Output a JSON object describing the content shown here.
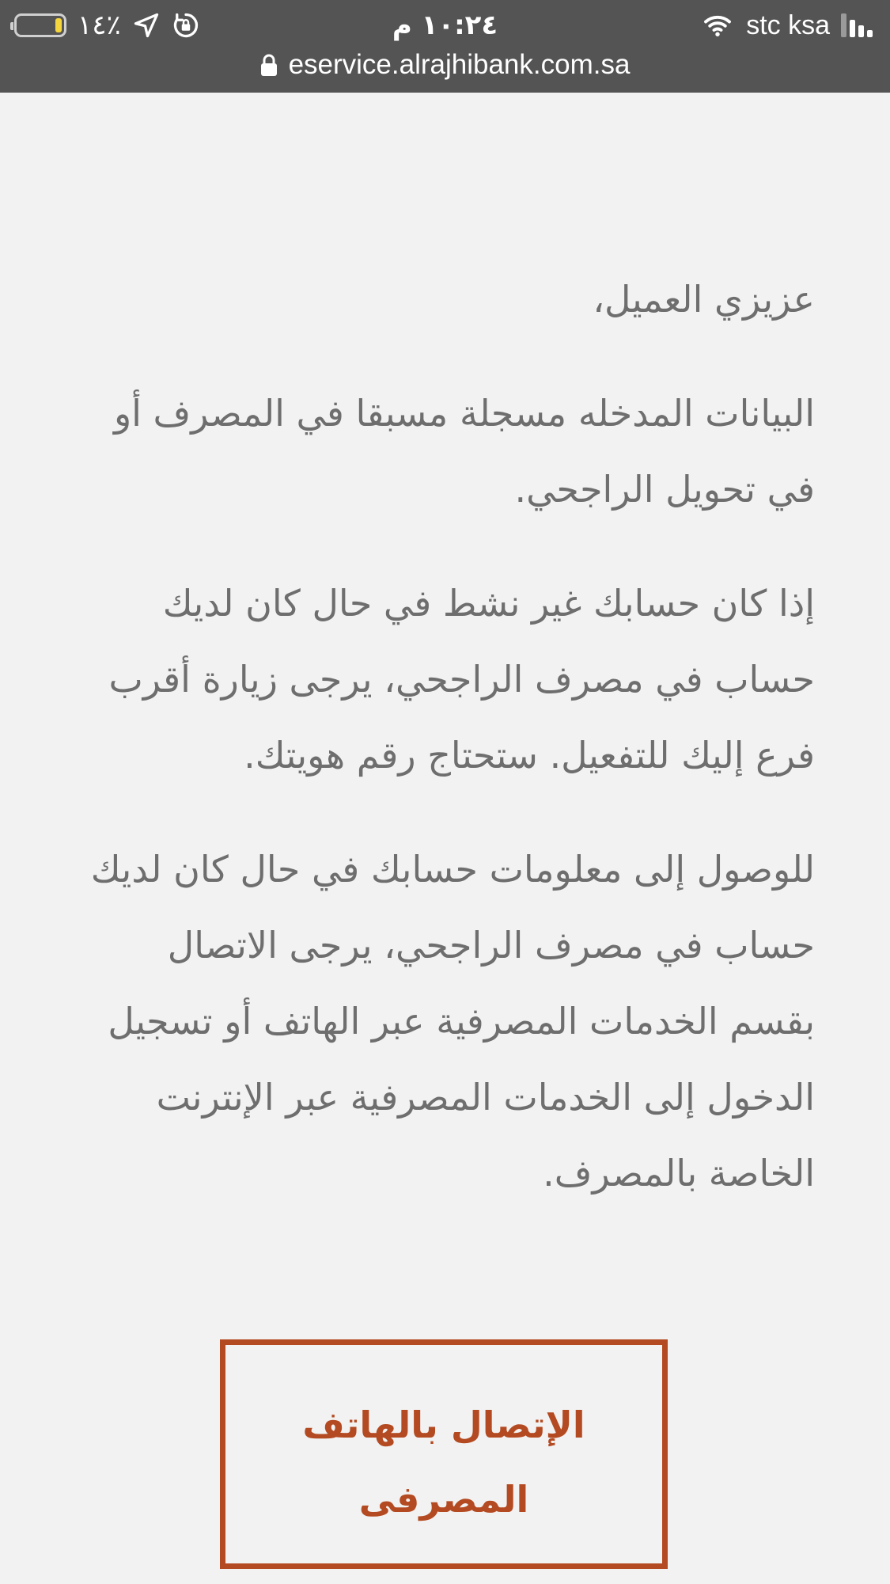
{
  "status_bar": {
    "battery_percent": "٪١٤",
    "time": "١٠:٢٤ م",
    "carrier": "stc ksa",
    "url": "eservice.alrajhibank.com.sa",
    "icons": [
      "battery-icon",
      "location-arrow-icon",
      "orientation-lock-icon",
      "wifi-icon",
      "signal-icon",
      "lock-icon"
    ],
    "battery_level": 0.14
  },
  "message": {
    "greeting": "عزيزي العميل،",
    "paragraph_1": "البيانات المدخله مسجلة مسبقا في المصرف أو في تحويل الراجحي.",
    "paragraph_2": "إذا كان حسابك غير نشط في حال كان لديك حساب في مصرف الراجحي، يرجى زيارة أقرب فرع إليك للتفعيل. ستحتاج رقم هويتك.",
    "paragraph_3": "للوصول إلى معلومات حسابك في حال كان لديك حساب في مصرف الراجحي، يرجى الاتصال بقسم الخدمات المصرفية عبر الهاتف أو تسجيل الدخول إلى الخدمات المصرفية عبر الإنترنت الخاصة بالمصرف."
  },
  "actions": {
    "phone_banking_label": "الإتصال بالهاتف المصرفى"
  },
  "colors": {
    "status_bar_bg": "#545454",
    "page_bg": "#f2f2f2",
    "body_text": "#6e6e6e",
    "accent": "#b44a21",
    "battery_fill": "#f5d63d"
  }
}
